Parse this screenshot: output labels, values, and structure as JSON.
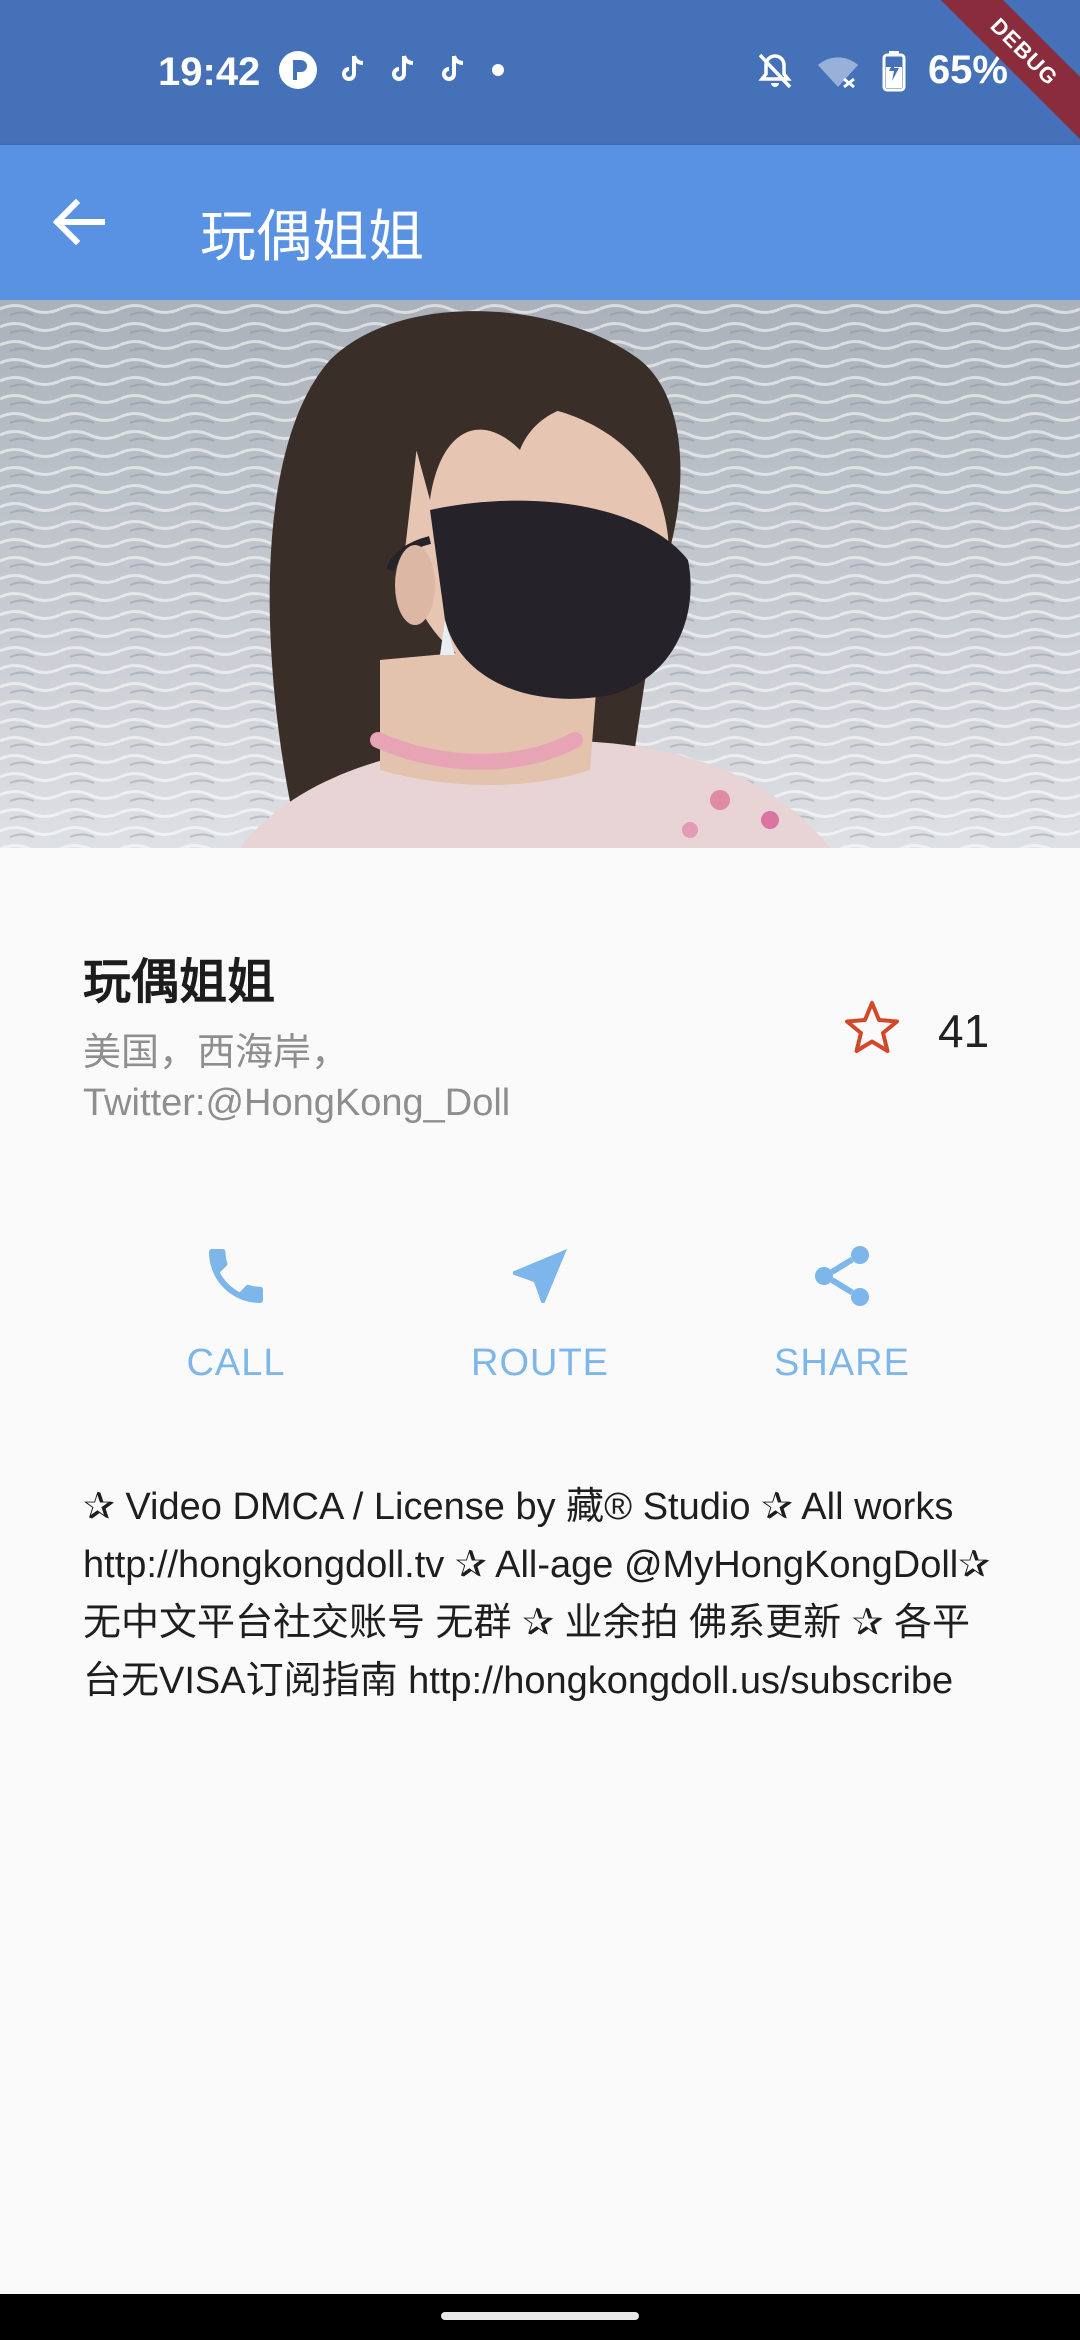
{
  "status_bar": {
    "time": "19:42",
    "battery_percent": "65%",
    "icons_left": [
      "p-app-icon",
      "tiktok-icon",
      "tiktok-icon",
      "tiktok-icon",
      "dot-icon"
    ],
    "icons_right": [
      "notifications-off-icon",
      "wifi-icon",
      "battery-charging-icon"
    ],
    "debug_label": "DEBUG"
  },
  "app_bar": {
    "title": "玩偶姐姐",
    "back_icon": "arrow-back-icon",
    "color": "#5992e3"
  },
  "profile": {
    "name": "玩偶姐姐",
    "location": "美国，西海岸，Twitter:@HongKong_Doll",
    "favorite_count": "41",
    "star_color": "#d2492a"
  },
  "actions": [
    {
      "label": "CALL",
      "icon": "phone-icon"
    },
    {
      "label": "ROUTE",
      "icon": "navigation-icon"
    },
    {
      "label": "SHARE",
      "icon": "share-icon"
    }
  ],
  "action_color": "#7db6ea",
  "description": "✰ Video DMCA / License by 藏® Studio ✰ All works http://hongkongdoll.tv ✰ All-age @MyHongKongDoll✰ 无中文平台社交账号 无群 ✰ 业余拍 佛系更新 ✰ 各平台无VISA订阅指南 http://hongkongdoll.us/subscribe"
}
